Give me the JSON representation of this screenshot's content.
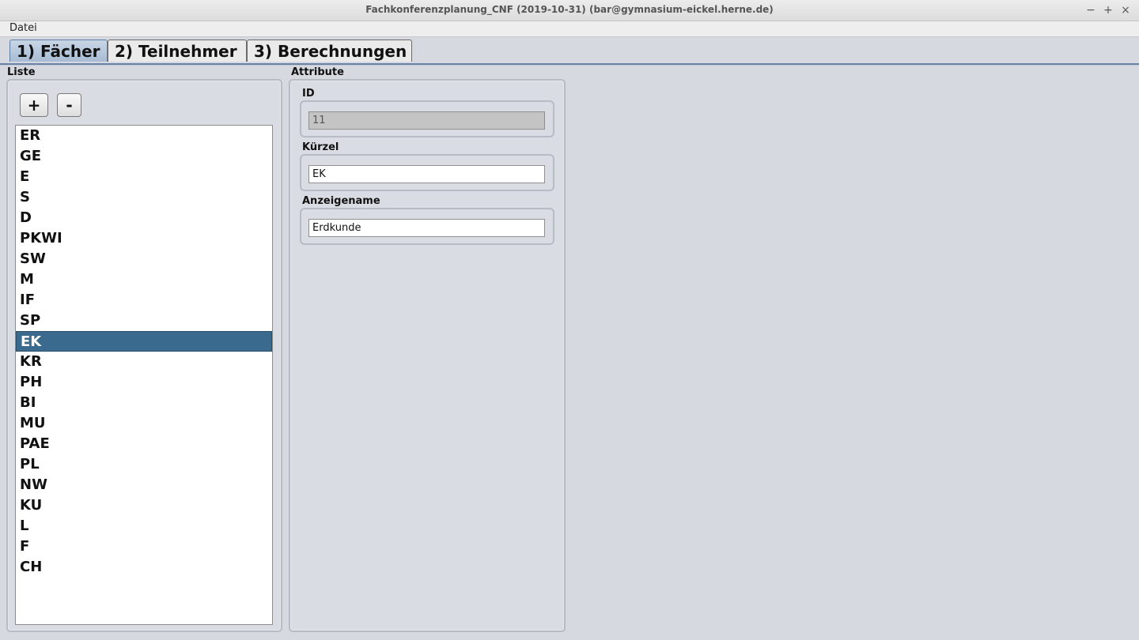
{
  "window": {
    "title": "Fachkonferenzplanung_CNF (2019-10-31) (bar@gymnasium-eickel.herne.de)",
    "minimize": "−",
    "maximize": "+",
    "close": "×"
  },
  "menubar": {
    "file": "Datei"
  },
  "tabs": [
    {
      "label": "1) Fächer",
      "active": true
    },
    {
      "label": "2) Teilnehmer",
      "active": false
    },
    {
      "label": "3) Berechnungen",
      "active": false
    }
  ],
  "list_panel": {
    "title": "Liste",
    "add_label": "+",
    "remove_label": "-",
    "items": [
      "ER",
      "GE",
      "E",
      "S",
      "D",
      "PKWI",
      "SW",
      "M",
      "IF",
      "SP",
      "EK",
      "KR",
      "PH",
      "BI",
      "MU",
      "PAE",
      "PL",
      "NW",
      "KU",
      "L",
      "F",
      "CH"
    ],
    "selected": "EK"
  },
  "attributes_panel": {
    "title": "Attribute",
    "id_label": "ID",
    "id_value": "11",
    "kuerzel_label": "Kürzel",
    "kuerzel_value": "EK",
    "anzeigename_label": "Anzeigename",
    "anzeigename_value": "Erdkunde"
  }
}
